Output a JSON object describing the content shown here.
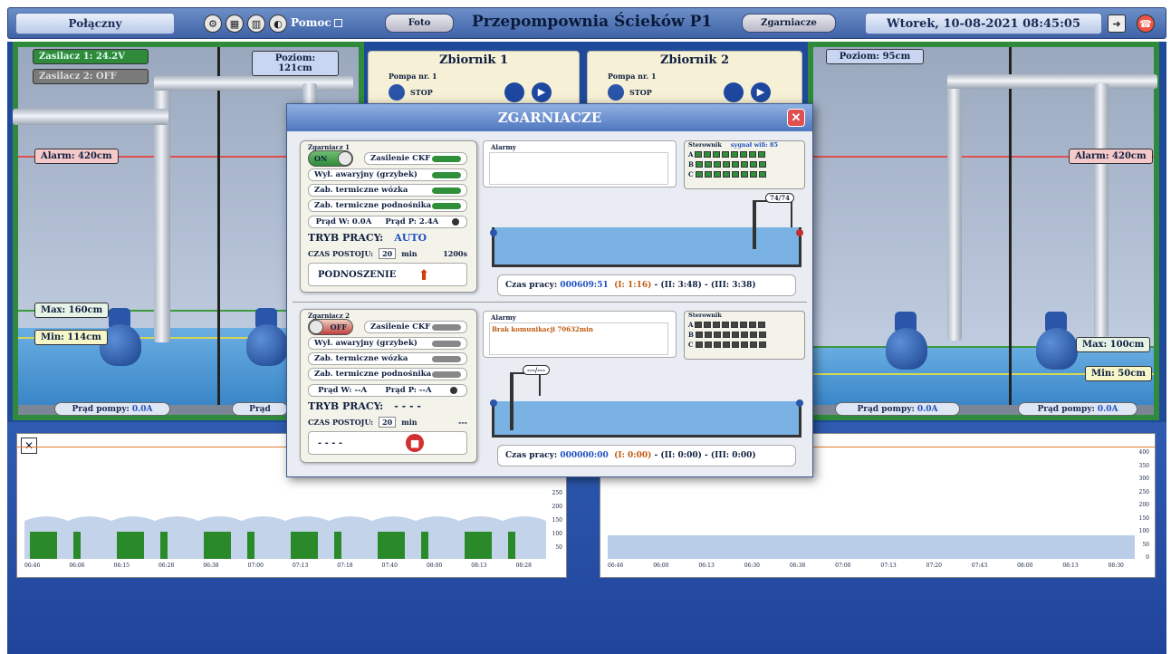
{
  "topbar": {
    "status": "Połączny",
    "help": "Pomoc",
    "photo": "Foto",
    "title": "Przepompownia Ścieków P1",
    "zgarniacze": "Zgarniacze",
    "datetime": "Wtorek, 10-08-2021 08:45:05"
  },
  "left_station": {
    "supply1": "Zasilacz 1: 24.2V",
    "supply2": "Zasilacz 2: OFF",
    "level": "Poziom: 121cm",
    "alarm": "Alarm: 420cm",
    "max": "Max: 160cm",
    "min": "Min: 114cm",
    "pump_current_label": "Prąd pompy:",
    "pump1_current": "0.0A",
    "pump2_current_label": "Prąd"
  },
  "right_station": {
    "level": "Poziom: 95cm",
    "alarm": "Alarm: 420cm",
    "max": "Max: 100cm",
    "min": "Min: 50cm",
    "pump_current_label": "Prąd pompy:",
    "pump1_current": "0.0A",
    "pump2_current": "0.0A"
  },
  "tanks": [
    {
      "title": "Zbiornik 1",
      "pump": "Pompa nr. 1",
      "state": "STOP"
    },
    {
      "title": "Zbiornik 2",
      "pump": "Pompa nr. 1",
      "state": "STOP"
    }
  ],
  "modal": {
    "title": "ZGARNIACZE",
    "z1": {
      "label": "Zgarniacz 1",
      "toggle": "ON",
      "power": "Zasilenie CKF",
      "emergency": "Wył. awaryjny (grzybek)",
      "thermal_cart": "Zab. termiczne wózka",
      "thermal_lift": "Zab. termiczne podnośnika",
      "current_w": "Prąd W: 0.0A",
      "current_p": "Prąd P: 2.4A",
      "mode_label": "TRYB PRACY:",
      "mode_value": "AUTO",
      "idle_label": "CZAS POSTOJU:",
      "idle_value": "20",
      "idle_unit": "min",
      "idle_total": "1200s",
      "action": "PODNOSZENIE",
      "alarms_label": "Alarmy",
      "alarm_text": "",
      "ster_label": "Sterownik",
      "signal": "sygnał wifi: 85",
      "row_labels": [
        "A",
        "B",
        "C"
      ],
      "pos_label": "74/74",
      "work_label": "Czas pracy:",
      "work_value": "000609:51",
      "work_i": "(I: 1:16)",
      "work_ii": "- (II: 3:48)",
      "work_iii": "- (III: 3:38)"
    },
    "z2": {
      "label": "Zgarniacz 2",
      "toggle": "OFF",
      "power": "Zasilenie CKF",
      "emergency": "Wył. awaryjny (grzybek)",
      "thermal_cart": "Zab. termiczne wózka",
      "thermal_lift": "Zab. termiczne podnośnika",
      "current_w": "Prąd W: --A",
      "current_p": "Prąd P: --A",
      "mode_label": "TRYB PRACY:",
      "mode_value": "- - - -",
      "idle_label": "CZAS POSTOJU:",
      "idle_value": "20",
      "idle_unit": "min",
      "idle_total": "---",
      "action": "- - - -",
      "alarms_label": "Alarmy",
      "alarm_text": "Brak komunikacji 70632min",
      "ster_label": "Sterownik",
      "row_labels": [
        "A",
        "B",
        "C"
      ],
      "pos_label": "---/---",
      "work_label": "Czas pracy:",
      "work_value": "000000:00",
      "work_i": "(I: 0:00)",
      "work_ii": "- (II: 0:00)",
      "work_iii": "- (III: 0:00)"
    }
  },
  "chart_data": [
    {
      "type": "area",
      "yticks": [
        "250",
        "200",
        "150",
        "100",
        "50"
      ],
      "xticks": [
        "06:46",
        "06:06",
        "06:15",
        "06:28",
        "06:38",
        "07:00",
        "07:13",
        "07:18",
        "07:40",
        "08:00",
        "08:13",
        "08:28"
      ]
    },
    {
      "type": "area",
      "yticks": [
        "400",
        "350",
        "300",
        "250",
        "200",
        "150",
        "100",
        "50",
        "0"
      ],
      "xticks": [
        "06:46",
        "06:00",
        "06:13",
        "06:30",
        "06:38",
        "07:00",
        "07:13",
        "07:20",
        "07:43",
        "08:00",
        "08:13",
        "08:30"
      ]
    }
  ],
  "colors": {
    "accent": "#3e62a6",
    "station_border": "#2f8a3c",
    "alarm_line": "#e05050",
    "led_green": "#2f8f3a"
  }
}
